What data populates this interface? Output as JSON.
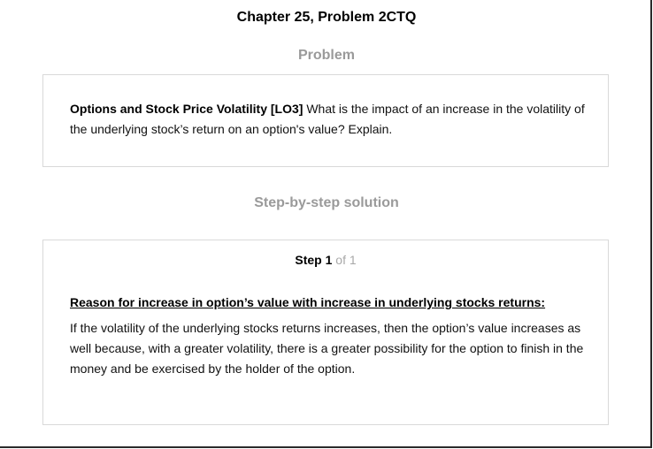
{
  "header": {
    "title": "Chapter 25, Problem 2CTQ"
  },
  "problem": {
    "heading": "Problem",
    "label": "Options and Stock Price Volatility [LO3]",
    "text": " What is the impact of an increase in the volatility of the underlying stock’s return on an option's value? Explain."
  },
  "solution": {
    "heading": "Step-by-step solution",
    "step": {
      "word": "Step",
      "number": "1",
      "of_total": "of 1"
    },
    "subheading": "Reason for increase in option’s value with increase in underlying stocks returns:",
    "body": "If the volatility of the underlying stocks returns increases, then the option’s value increases as well because, with a greater volatility, there is a greater possibility for the option to finish in the money and be exercised by the holder of the option."
  }
}
